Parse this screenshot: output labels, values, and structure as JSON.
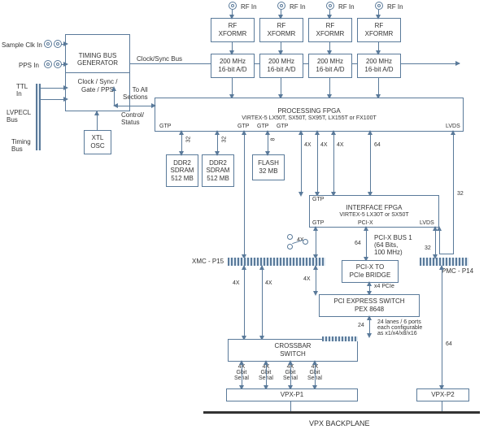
{
  "inputs": {
    "sample_clk": "Sample Clk In",
    "pps_in": "PPS In",
    "ttl_in": "TTL\nIn",
    "lvpecl_bus": "LVPECL\nBus",
    "timing_bus": "Timing\nBus"
  },
  "timing_gen": {
    "title": "TIMING BUS\nGENERATOR",
    "sub": "Clock / Sync /\nGate / PPS"
  },
  "clock_sync_bus": "Clock/Sync Bus",
  "xtl_osc": "XTL\nOSC",
  "rf_in": "RF In",
  "rf_xformr": "RF\nXFORMR",
  "adc": "200 MHz\n16-bit A/D",
  "proc_fpga": {
    "title": "PROCESSING FPGA",
    "sub": "VIRTEX-5 LX50T, SX50T, SX95T, LX155T or FX100T",
    "gtp": "GTP",
    "lvds": "LVDS"
  },
  "ctrl_status": "Control/\nStatus",
  "to_all": "To All\nSections",
  "ddr2": "DDR2\nSDRAM\n512 MB",
  "flash": "FLASH\n32 MB",
  "iface_fpga": {
    "title": "INTERFACE FPGA",
    "sub": "VIRTEX-5 LX30T or SX50T",
    "gtp": "GTP",
    "pcix": "PCI-X",
    "lvds": "LVDS"
  },
  "xmc": "XMC - P15",
  "pmc": "PMC - P14",
  "pcix_bus": "PCI-X BUS 1\n(64 Bits,\n100 MHz)",
  "pcix_bridge": "PCI-X TO\nPCIe BRIDGE",
  "pcie_x4": "x4 PCIe",
  "pex": "PCI EXPRESS SWITCH\nPEX 8648",
  "pex_lanes": "24 lanes / 6 ports\neach configurable\nas x1/x4/x8/x16",
  "crossbar": "CROSSBAR\nSWITCH",
  "gbit": "4X\nGbit\nSerial",
  "vpx_p1": "VPX-P1",
  "vpx_p2": "VPX-P2",
  "backplane": "VPX BACKPLANE",
  "bitw": {
    "b4x": "4X",
    "b8": "8",
    "b24": "24",
    "b32": "32",
    "b64": "64"
  }
}
